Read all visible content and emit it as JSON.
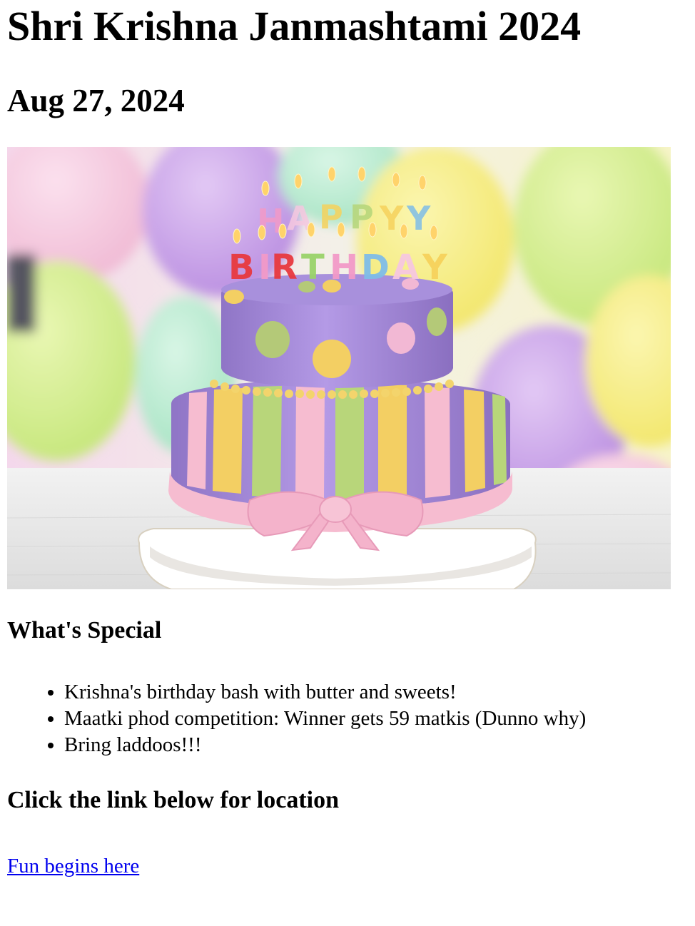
{
  "title": "Shri Krishna Janmashtami 2024",
  "date": "Aug 27, 2024",
  "hero_image": {
    "description": "Two-tier purple fondant birthday cake with pastel stripes, polka dots, pink bow, and HAPPY BIRTHDAY candles in front of colorful balloons",
    "candle_text_line1": "HAPPY",
    "candle_text_line2": "BIRTHDAY"
  },
  "special_section": {
    "heading": "What's Special",
    "items": [
      "Krishna's birthday bash with butter and sweets!",
      "Maatki phod competition: Winner gets 59 matkis (Dunno why)",
      "Bring laddoos!!!"
    ]
  },
  "location_section": {
    "heading": "Click the link below for location",
    "link_text": "Fun begins here"
  },
  "colors": {
    "link": "#0000ee",
    "text": "#000000",
    "background": "#ffffff",
    "cake_purple": "#a48ad8",
    "ribbon_pink": "#f6bcd0",
    "ribbon_yellow": "#f3cf63",
    "ribbon_green": "#b8d67a"
  }
}
